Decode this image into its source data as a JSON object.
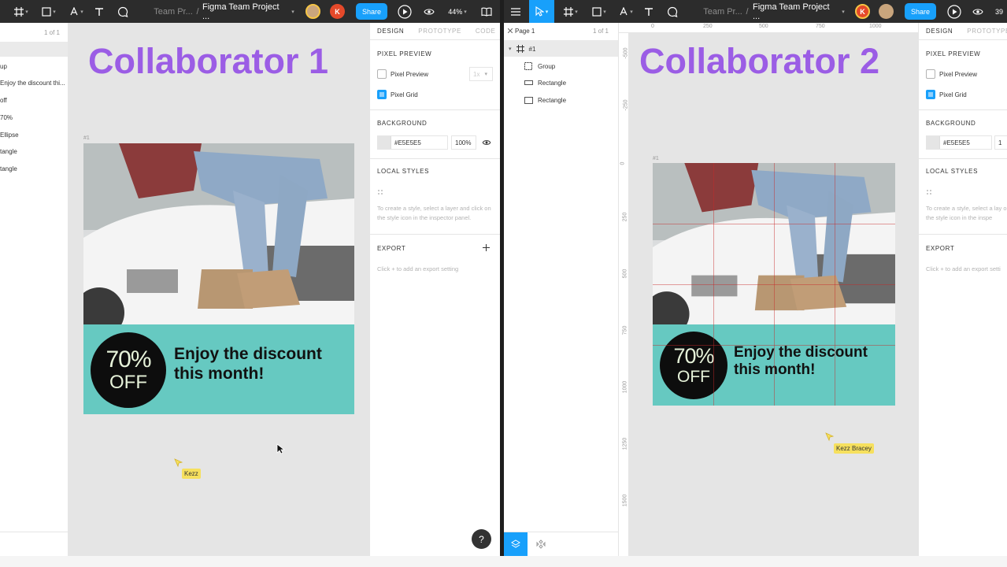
{
  "left": {
    "toolbar": {
      "team_short": "Team Pr...",
      "separator": "/",
      "file_name": "Figma Team Project ...",
      "share_label": "Share",
      "avatar_k": "K",
      "zoom": "44%"
    },
    "layers": {
      "page_count": "1 of 1",
      "items": [
        "up",
        "Enjoy the discount thi...",
        "off",
        "70%",
        "Ellipse",
        "tangle",
        "tangle"
      ]
    },
    "canvas": {
      "title": "Collaborator 1",
      "frame_label": "#1",
      "badge_big": "70%",
      "badge_small": "OFF",
      "promo_line1": "Enjoy the discount",
      "promo_line2": "this month!",
      "cursor_name": "Kezz"
    },
    "panel": {
      "tabs": [
        "DESIGN",
        "PROTOTYPE",
        "CODE"
      ],
      "pixel_preview_title": "PIXEL PREVIEW",
      "pixel_preview_label": "Pixel Preview",
      "pixel_preview_scale": "1x",
      "pixel_grid_label": "Pixel Grid",
      "background_title": "BACKGROUND",
      "bg_hex": "#E5E5E5",
      "bg_opacity": "100%",
      "local_styles_title": "LOCAL STYLES",
      "local_styles_hint": "To create a style, select a layer and click on the style icon in the inspector panel.",
      "export_title": "EXPORT",
      "export_hint": "Click + to add an export setting",
      "help": "?"
    }
  },
  "right": {
    "toolbar": {
      "team_short": "Team Pr...",
      "separator": "/",
      "file_name": "Figma Team Project ...",
      "share_label": "Share",
      "avatar_k": "K",
      "zoom": "39"
    },
    "layers": {
      "page_name": "Page 1",
      "page_count": "1 of 1",
      "frame_name": "#1",
      "items": [
        "Group",
        "Rectangle",
        "Rectangle"
      ]
    },
    "rulers": {
      "top": [
        "0",
        "250",
        "500",
        "750",
        "1000"
      ],
      "left": [
        "-500",
        "-250",
        "0",
        "250",
        "500",
        "750",
        "1000",
        "1250",
        "1500"
      ]
    },
    "canvas": {
      "title": "Collaborator 2",
      "frame_label": "#1",
      "badge_big": "70%",
      "badge_small": "OFF",
      "promo_line1": "Enjoy the discount",
      "promo_line2": "this month!",
      "cursor_name": "Kezz Bracey"
    },
    "panel": {
      "tabs": [
        "DESIGN",
        "PROTOTYPE"
      ],
      "pixel_preview_title": "PIXEL PREVIEW",
      "pixel_preview_label": "Pixel Preview",
      "pixel_grid_label": "Pixel Grid",
      "background_title": "BACKGROUND",
      "bg_hex": "#E5E5E5",
      "bg_opacity": "1",
      "local_styles_title": "LOCAL STYLES",
      "local_styles_hint": "To create a style, select a lay on the style icon in the inspe",
      "export_title": "EXPORT",
      "export_hint": "Click + to add an export setti"
    }
  },
  "colors": {
    "toolbar": "#2c2c2c",
    "accent": "#18a0fb",
    "title_purple": "#9b5de5",
    "banner_teal": "#66c9c1",
    "cursor_yellow": "#f6e05e",
    "canvas_bg": "#e5e5e5"
  },
  "icons": [
    "frame-tool-icon",
    "rectangle-tool-icon",
    "pen-tool-icon",
    "text-tool-icon",
    "comment-tool-icon",
    "present-icon",
    "eye-icon",
    "library-icon",
    "menu-icon",
    "move-tool-icon",
    "layers-icon",
    "assets-icon",
    "help-icon",
    "cursor-icon",
    "plus-icon"
  ]
}
